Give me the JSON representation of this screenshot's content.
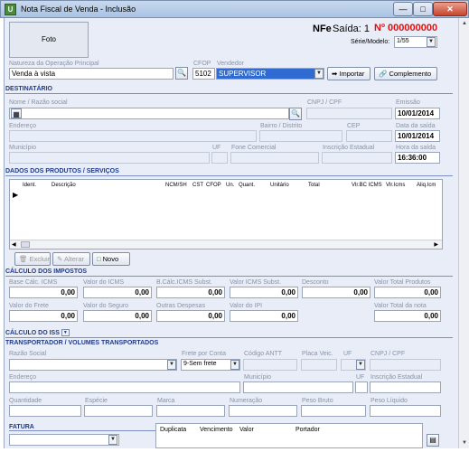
{
  "window": {
    "title": "Nota Fiscal de Venda - Inclusão",
    "minimize": "—",
    "maximize": "□",
    "close": "✕",
    "app_icon": "app-icon"
  },
  "header": {
    "foto": "Foto",
    "nfe_label": "NFe",
    "saida_label": "Saída: 1",
    "numero": "Nº 000000000",
    "serie_label": "Série/Modelo:",
    "serie_value": "1/55"
  },
  "natureza": {
    "label": "Natureza da Operação Principal",
    "value": "Venda à vista"
  },
  "cfop": {
    "label": "CFOP",
    "value": "5102"
  },
  "vendedor": {
    "label": "Vendedor",
    "value": "SUPERVISOR"
  },
  "buttons": {
    "importar": "Importar",
    "complemento": "Complemento"
  },
  "destinatario": {
    "title": "DESTINATÁRIO",
    "nome_label": "Nome / Razão social",
    "cnpj_label": "CNPJ / CPF",
    "emissao_label": "Emissão",
    "emissao_value": "10/01/2014",
    "endereco_label": "Endereço",
    "bairro_label": "Bairro / Distrito",
    "cep_label": "CEP",
    "data_saida_label": "Data da saída",
    "data_saida_value": "10/01/2014",
    "municipio_label": "Município",
    "uf_label": "UF",
    "fone_label": "Fone Comercial",
    "ie_label": "Inscrição Estadual",
    "hora_label": "Hora da saída",
    "hora_value": "16:36:00"
  },
  "produtos": {
    "title": "DADOS DOS PRODUTOS / SERVIÇOS",
    "columns": [
      "Ident.",
      "Descrição",
      "NCM/SH",
      "CST",
      "CFOP",
      "Un.",
      "Quant.",
      "Unitário",
      "Total",
      "Vlr.BC ICMS",
      "Vlr.Icms",
      "Aliq.Icm"
    ],
    "excluir": "Excluir",
    "alterar": "Alterar",
    "novo": "Novo"
  },
  "impostos": {
    "title": "CÁLCULO DOS IMPOSTOS",
    "base_icms_label": "Base Cálc. ICMS",
    "base_icms": "0,00",
    "valor_icms_label": "Valor do ICMS",
    "valor_icms": "0,00",
    "bc_subst_label": "B.Cálc.ICMS Subst.",
    "bc_subst": "0,00",
    "icms_subst_label": "Valor ICMS Subst.",
    "icms_subst": "0,00",
    "desconto_label": "Desconto",
    "desconto": "0,00",
    "total_produtos_label": "Valor Total Produtos",
    "total_produtos": "0,00",
    "frete_label": "Valor do Frete",
    "frete": "0,00",
    "seguro_label": "Valor do Seguro",
    "seguro": "0,00",
    "outras_label": "Outras Despesas",
    "outras": "0,00",
    "ipi_label": "Valor do IPI",
    "ipi": "0,00",
    "total_nota_label": "Valor Total da nota",
    "total_nota": "0,00"
  },
  "iss": {
    "title": "CÁLCULO DO ISS"
  },
  "transporte": {
    "title": "TRANSPORTADOR / VOLUMES TRANSPORTADOS",
    "razao_label": "Razão Social",
    "frete_conta_label": "Frete por Conta",
    "frete_conta_value": "9-Sem frete",
    "antt_label": "Código ANTT",
    "placa_label": "Placa Veic.",
    "uf_label": "UF",
    "cnpj_label": "CNPJ / CPF",
    "endereco_label": "Endereço",
    "municipio_label": "Município",
    "uf2_label": "UF",
    "ie_label": "Inscrição Estadual",
    "quantidade_label": "Quantidade",
    "especie_label": "Espécie",
    "marca_label": "Marca",
    "numeracao_label": "Numeração",
    "peso_bruto_label": "Peso Bruto",
    "peso_liquido_label": "Peso Líquido"
  },
  "fatura": {
    "title": "FATURA",
    "columns": [
      "Duplicata",
      "Vencimento",
      "Valor",
      "Portador"
    ]
  }
}
